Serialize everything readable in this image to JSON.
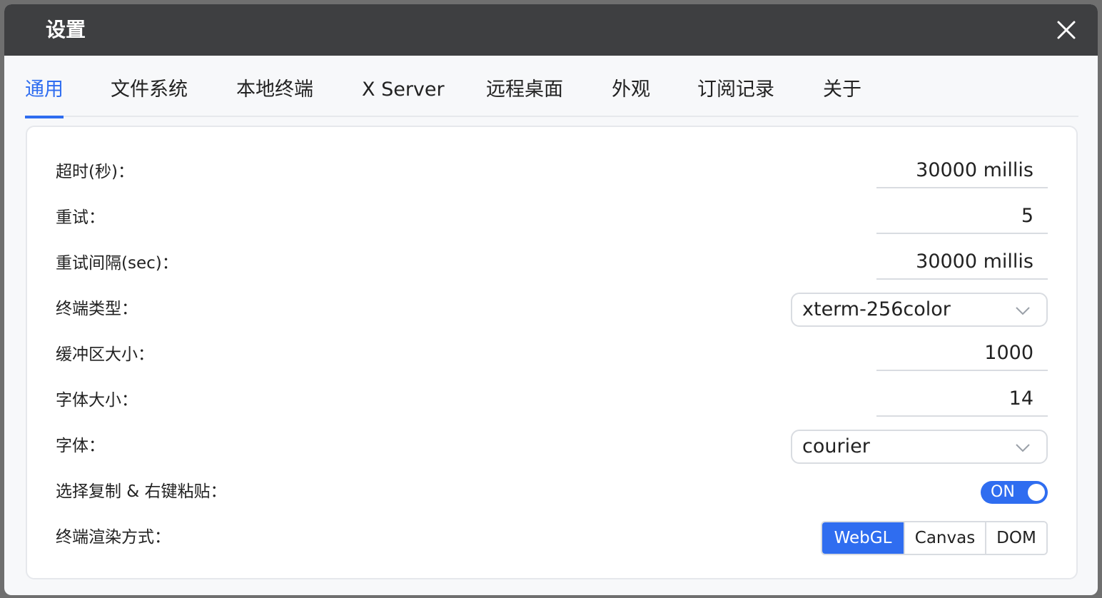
{
  "dialog": {
    "title": "设置",
    "close_icon": "close-icon"
  },
  "tabs": [
    {
      "label": "通用",
      "active": true
    },
    {
      "label": "文件系统",
      "active": false
    },
    {
      "label": "本地终端",
      "active": false
    },
    {
      "label": "X Server",
      "active": false
    },
    {
      "label": "远程桌面",
      "active": false
    },
    {
      "label": "外观",
      "active": false
    },
    {
      "label": "订阅记录",
      "active": false
    },
    {
      "label": "关于",
      "active": false
    }
  ],
  "settings": {
    "timeout": {
      "label": "超时(秒)：",
      "value": "30000 millis"
    },
    "retry": {
      "label": "重试：",
      "value": "5"
    },
    "retry_interval": {
      "label": "重试间隔(sec)：",
      "value": "30000 millis"
    },
    "terminal_type": {
      "label": "终端类型：",
      "value": "xterm-256color"
    },
    "buffer_size": {
      "label": "缓冲区大小：",
      "value": "1000"
    },
    "font_size": {
      "label": "字体大小：",
      "value": "14"
    },
    "font": {
      "label": "字体：",
      "value": "courier"
    },
    "select_copy": {
      "label": "选择复制 & 右键粘贴：",
      "toggle": "ON",
      "on": true
    },
    "render_mode": {
      "label": "终端渲染方式：",
      "options": [
        "WebGL",
        "Canvas",
        "DOM"
      ],
      "selected": "WebGL"
    }
  },
  "colors": {
    "accent": "#2f6df0",
    "titlebar": "#3e3f41"
  }
}
